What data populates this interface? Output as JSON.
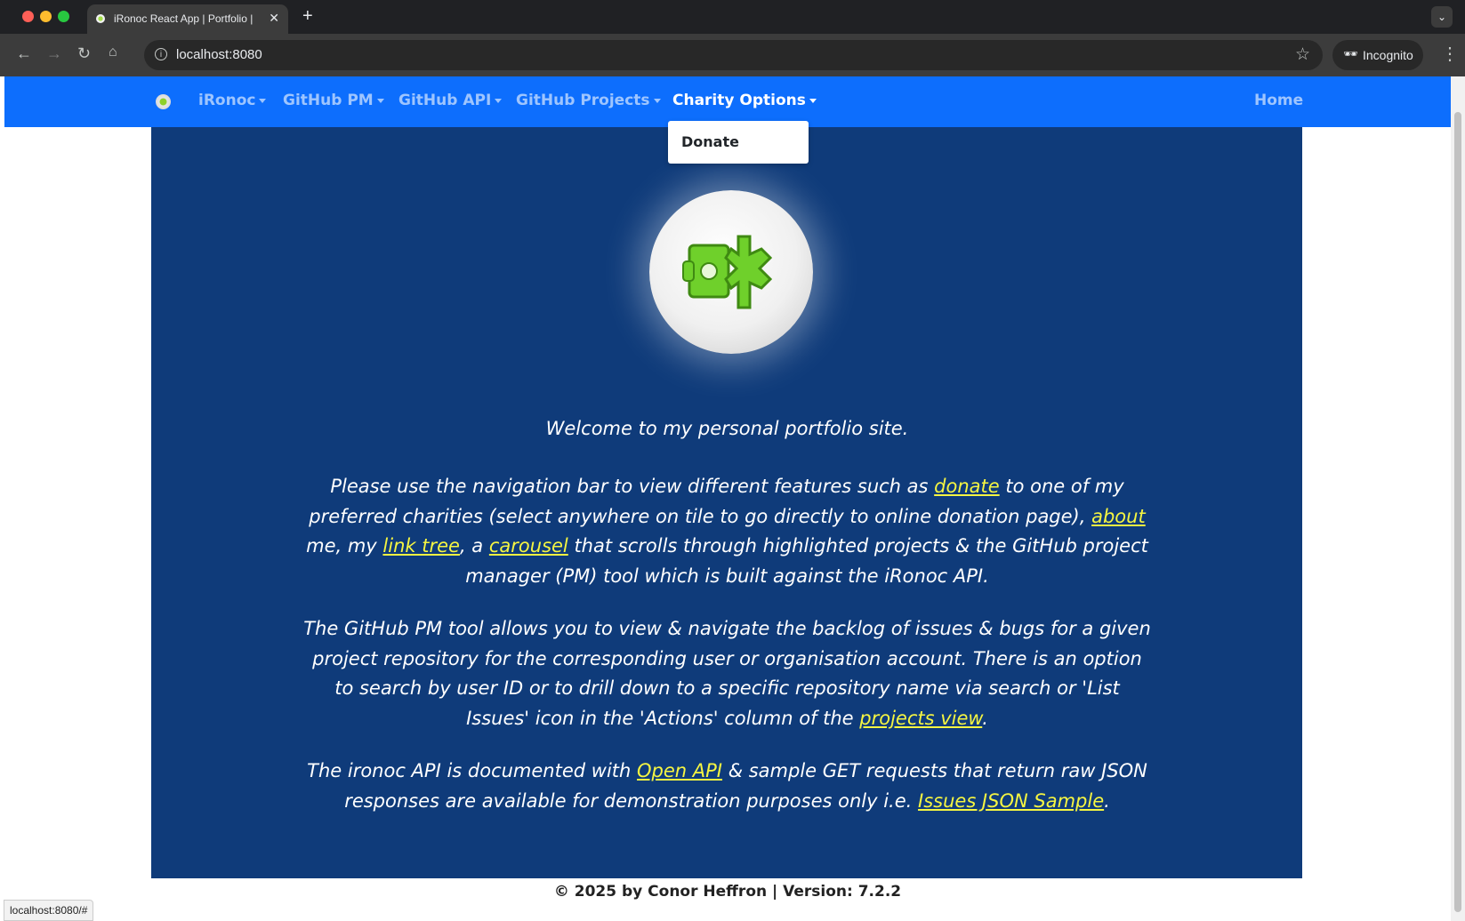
{
  "browser": {
    "tab_title": "iRonoc React App | Portfolio |",
    "new_tab": "+",
    "tab_close": "✕",
    "url": "localhost:8080",
    "profile_label": "Incognito",
    "status_url": "localhost:8080/#"
  },
  "navbar": {
    "menus": [
      "iRonoc",
      "GitHub PM",
      "GitHub API",
      "GitHub Projects",
      "Charity Options"
    ],
    "active_menu": "Charity Options",
    "home": "Home",
    "color": "#0d6efd"
  },
  "dropdown": {
    "items": [
      "Donate"
    ]
  },
  "content": {
    "welcome": "Welcome to my personal portfolio site.",
    "p1": {
      "a": "Please use the navigation bar to view different features such as ",
      "donate": "donate",
      "b": "  to one of my preferred charities (select anywhere on tile to go directly to online donation page), ",
      "about": "about",
      "c": " me, my ",
      "linktree": "link tree",
      "d": ", a ",
      "carousel": "carousel",
      "e": " that scrolls through highlighted projects & the GitHub project manager (PM) tool which is built against the iRonoc API."
    },
    "p2": {
      "a": "The GitHub PM tool allows you to view & navigate the backlog of issues & bugs for a given project repository for the corresponding user or organisation account. There is an option to search by user ID or to drill down to a specific repository name via search or 'List Issues' icon in the 'Actions' column of the ",
      "projects_view": "projects view",
      "b": "."
    },
    "p3": {
      "a": "The ironoc API is documented with  ",
      "openapi": "Open API",
      "b": "  & sample GET requests that return raw JSON responses are available for demonstration purposes only i.e.  ",
      "issues_json": "Issues JSON Sample",
      "c": "."
    },
    "panel_color": "#0f3b7a",
    "link_color": "#f5f542"
  },
  "footer": "© 2025 by Conor Heffron | Version: 7.2.2"
}
